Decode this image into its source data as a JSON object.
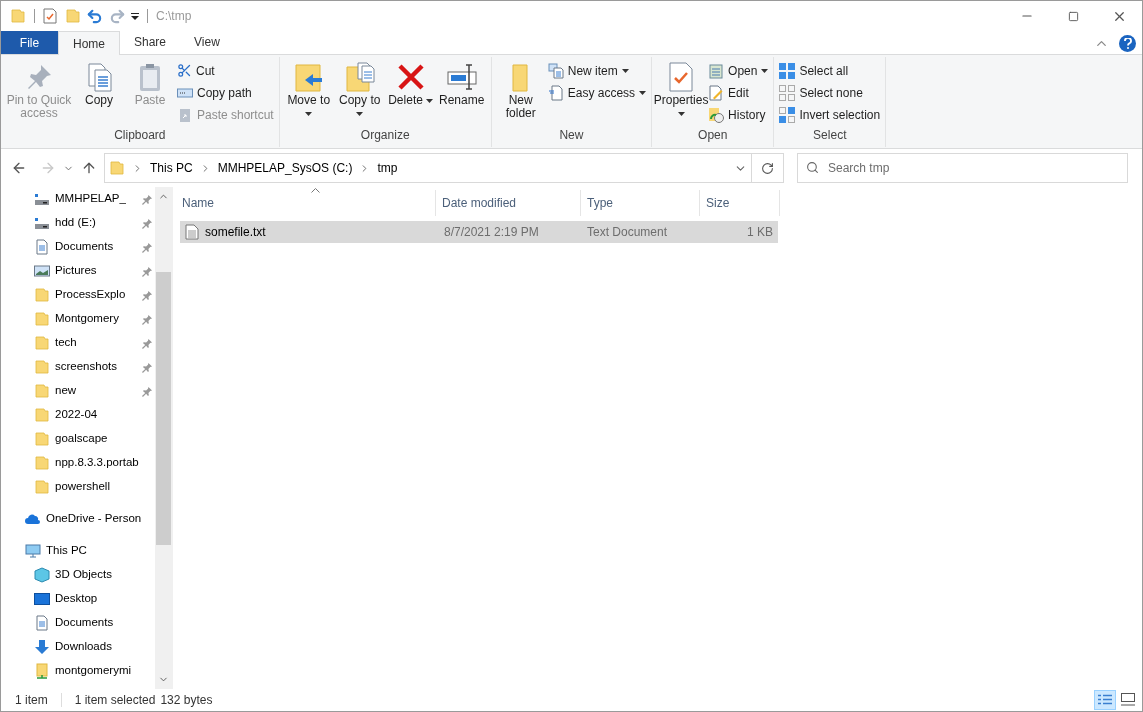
{
  "window": {
    "title": "C:\\tmp"
  },
  "quick_access_toolbar": {
    "undo_enabled": true,
    "redo_enabled": false
  },
  "tabs": [
    {
      "label": "File",
      "kind": "file",
      "selected": false
    },
    {
      "label": "Home",
      "kind": "tab",
      "selected": true
    },
    {
      "label": "Share",
      "kind": "tab",
      "selected": false
    },
    {
      "label": "View",
      "kind": "tab",
      "selected": false
    }
  ],
  "ribbon": {
    "groups": [
      {
        "label": "Clipboard",
        "items": [
          {
            "label": "Pin to Quick access",
            "kind": "large",
            "disabled": true,
            "dropdown": false
          },
          {
            "label": "Copy",
            "kind": "large",
            "disabled": false,
            "dropdown": false
          },
          {
            "label": "Paste",
            "kind": "large",
            "disabled": true,
            "dropdown": false
          },
          {
            "label": "Cut",
            "kind": "small",
            "disabled": false,
            "dropdown": false
          },
          {
            "label": "Copy path",
            "kind": "small",
            "disabled": false,
            "dropdown": false
          },
          {
            "label": "Paste shortcut",
            "kind": "small",
            "disabled": true,
            "dropdown": false
          }
        ]
      },
      {
        "label": "Organize",
        "items": [
          {
            "label": "Move to",
            "kind": "large",
            "disabled": false,
            "dropdown": true
          },
          {
            "label": "Copy to",
            "kind": "large",
            "disabled": false,
            "dropdown": true
          },
          {
            "label": "Delete",
            "kind": "large",
            "disabled": false,
            "dropdown": true
          },
          {
            "label": "Rename",
            "kind": "large",
            "disabled": false,
            "dropdown": false
          }
        ]
      },
      {
        "label": "New",
        "items": [
          {
            "label": "New folder",
            "kind": "large",
            "disabled": false,
            "dropdown": false
          },
          {
            "label": "New item",
            "kind": "small",
            "disabled": false,
            "dropdown": true
          },
          {
            "label": "Easy access",
            "kind": "small",
            "disabled": false,
            "dropdown": true
          }
        ]
      },
      {
        "label": "Open",
        "items": [
          {
            "label": "Properties",
            "kind": "large",
            "disabled": false,
            "dropdown": true
          },
          {
            "label": "Open",
            "kind": "small",
            "disabled": false,
            "dropdown": true
          },
          {
            "label": "Edit",
            "kind": "small",
            "disabled": false,
            "dropdown": false
          },
          {
            "label": "History",
            "kind": "small",
            "disabled": false,
            "dropdown": false
          }
        ]
      },
      {
        "label": "Select",
        "items": [
          {
            "label": "Select all",
            "kind": "small",
            "disabled": false,
            "dropdown": false
          },
          {
            "label": "Select none",
            "kind": "small",
            "disabled": false,
            "dropdown": false
          },
          {
            "label": "Invert selection",
            "kind": "small",
            "disabled": false,
            "dropdown": false
          }
        ]
      }
    ]
  },
  "address_bar": {
    "back_enabled": true,
    "forward_enabled": false,
    "breadcrumbs": [
      "This PC",
      "MMHPELAP_SysOS (C:)",
      "tmp"
    ]
  },
  "search": {
    "placeholder": "Search tmp"
  },
  "navigation": {
    "quick_access_items": [
      {
        "label": "MMHPELAP_",
        "kind": "drive",
        "pinned": true
      },
      {
        "label": "hdd (E:)",
        "kind": "drive",
        "pinned": true
      },
      {
        "label": "Documents",
        "kind": "documents",
        "pinned": true
      },
      {
        "label": "Pictures",
        "kind": "pictures",
        "pinned": true
      },
      {
        "label": "ProcessExplo",
        "kind": "folder",
        "pinned": true
      },
      {
        "label": "Montgomery",
        "kind": "folder",
        "pinned": true
      },
      {
        "label": "tech",
        "kind": "folder",
        "pinned": true
      },
      {
        "label": "screenshots",
        "kind": "folder",
        "pinned": true
      },
      {
        "label": "new",
        "kind": "folder",
        "pinned": true
      },
      {
        "label": "2022-04",
        "kind": "folder",
        "pinned": false
      },
      {
        "label": "goalscape",
        "kind": "folder",
        "pinned": false
      },
      {
        "label": "npp.8.3.3.portab",
        "kind": "folder",
        "pinned": false
      },
      {
        "label": "powershell",
        "kind": "folder",
        "pinned": false
      }
    ],
    "tree": [
      {
        "label": "OneDrive - Person",
        "kind": "cloud"
      },
      {
        "label": "This PC",
        "kind": "pc",
        "children": [
          {
            "label": "3D Objects",
            "kind": "cube"
          },
          {
            "label": "Desktop",
            "kind": "desktop"
          },
          {
            "label": "Documents",
            "kind": "documents"
          },
          {
            "label": "Downloads",
            "kind": "download"
          },
          {
            "label": "montgomerymi",
            "kind": "user-folder"
          }
        ]
      }
    ]
  },
  "file_list": {
    "columns": [
      "Name",
      "Date modified",
      "Type",
      "Size"
    ],
    "rows": [
      {
        "name": "somefile.txt",
        "date_modified": "8/7/2021 2:19 PM",
        "type": "Text Document",
        "size": "1 KB",
        "selected": true
      }
    ]
  },
  "status_bar": {
    "item_count": "1 item",
    "selection": "1 item selected",
    "selection_size": "132 bytes"
  },
  "view_buttons": [
    {
      "kind": "details",
      "selected": true
    },
    {
      "kind": "large-icons",
      "selected": false
    }
  ]
}
